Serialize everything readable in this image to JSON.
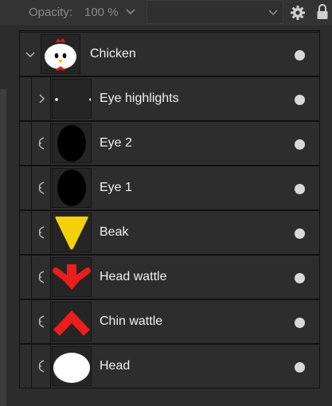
{
  "toolbar": {
    "opacity_label": "Opacity:",
    "opacity_value": "100 %",
    "blend_mode": ""
  },
  "layers": [
    {
      "name": "Chicken",
      "type": "group",
      "expanded": true
    },
    {
      "name": "Eye highlights",
      "type": "group",
      "expanded": false
    },
    {
      "name": "Eye 2",
      "type": "shape",
      "fill": "#000000"
    },
    {
      "name": "Eye 1",
      "type": "shape",
      "fill": "#000000"
    },
    {
      "name": "Beak",
      "type": "shape",
      "fill": "#f5d10a"
    },
    {
      "name": "Head wattle",
      "type": "shape",
      "fill": "#ee1c1c"
    },
    {
      "name": "Chin wattle",
      "type": "shape",
      "fill": "#ee1c1c"
    },
    {
      "name": "Head",
      "type": "shape",
      "fill": "#ffffff"
    }
  ],
  "icons": {
    "expand_open": "chevron-down-icon",
    "expand_closed": "chevron-right-icon",
    "clip": "clip-mask-icon",
    "visibility": "visibility-dot-icon",
    "settings": "gear-icon",
    "lock": "lock-icon"
  },
  "colors": {
    "panel_bg": "#2b2b2b",
    "row_bg": "#2d2d2d",
    "text": "#f0f0f0",
    "muted": "#8a8a8a"
  }
}
